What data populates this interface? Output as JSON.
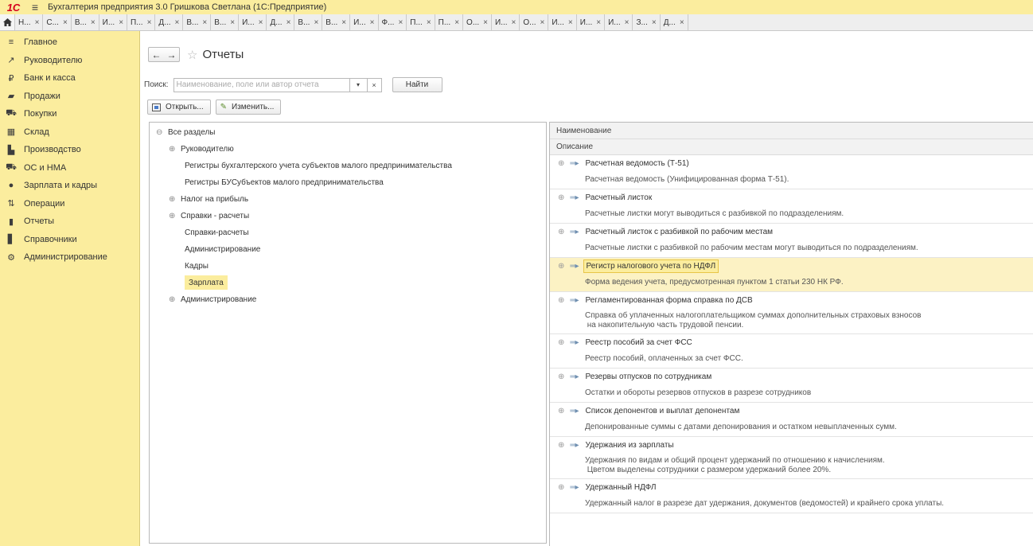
{
  "app": {
    "logo": "1С",
    "title": "Бухгалтерия предприятия 3.0 Гришкова Светлана  (1С:Предприятие)"
  },
  "tabs": [
    {
      "label": "Н..."
    },
    {
      "label": "С..."
    },
    {
      "label": "В..."
    },
    {
      "label": "И..."
    },
    {
      "label": "П..."
    },
    {
      "label": "Д..."
    },
    {
      "label": "В..."
    },
    {
      "label": "В..."
    },
    {
      "label": "И..."
    },
    {
      "label": "Д..."
    },
    {
      "label": "В..."
    },
    {
      "label": "В..."
    },
    {
      "label": "И..."
    },
    {
      "label": "Ф..."
    },
    {
      "label": "П..."
    },
    {
      "label": "П..."
    },
    {
      "label": "О..."
    },
    {
      "label": "И..."
    },
    {
      "label": "О..."
    },
    {
      "label": "И..."
    },
    {
      "label": "И..."
    },
    {
      "label": "И..."
    },
    {
      "label": "З..."
    },
    {
      "label": "Д..."
    }
  ],
  "sidebar": {
    "items": [
      {
        "label": "Главное",
        "icon": "menu-lines-icon"
      },
      {
        "label": "Руководителю",
        "icon": "trend-icon"
      },
      {
        "label": "Банк и касса",
        "icon": "ruble-icon"
      },
      {
        "label": "Продажи",
        "icon": "bag-icon"
      },
      {
        "label": "Покупки",
        "icon": "cart-icon"
      },
      {
        "label": "Склад",
        "icon": "warehouse-icon"
      },
      {
        "label": "Производство",
        "icon": "factory-icon"
      },
      {
        "label": "ОС и НМА",
        "icon": "truck-icon"
      },
      {
        "label": "Зарплата и кадры",
        "icon": "person-icon"
      },
      {
        "label": "Операции",
        "icon": "dt-kt-icon"
      },
      {
        "label": "Отчеты",
        "icon": "bar-chart-icon"
      },
      {
        "label": "Справочники",
        "icon": "book-icon"
      },
      {
        "label": "Администрирование",
        "icon": "gear-icon"
      }
    ]
  },
  "page": {
    "title": "Отчеты",
    "search_label": "Поиск:",
    "search_placeholder": "Наименование, поле или автор отчета",
    "find_label": "Найти",
    "open_label": "Открыть...",
    "edit_label": "Изменить..."
  },
  "tree": {
    "items": [
      {
        "label": "Все разделы",
        "exp": "⊖"
      },
      {
        "label": "Руководителю",
        "exp": "⊕"
      },
      {
        "label": "Регистры бухгалтерского учета субъектов малого предпринимательства",
        "exp": ""
      },
      {
        "label": "Регистры БУСубъектов малого предпринимательства",
        "exp": ""
      },
      {
        "label": "Налог на прибыль",
        "exp": "⊕"
      },
      {
        "label": "Справки - расчеты",
        "exp": "⊕"
      },
      {
        "label": "Справки-расчеты",
        "exp": ""
      },
      {
        "label": "Администрирование",
        "exp": ""
      },
      {
        "label": "Кадры",
        "exp": ""
      },
      {
        "label": "Зарплата",
        "exp": ""
      },
      {
        "label": "Администрирование",
        "exp": "⊕"
      }
    ]
  },
  "list": {
    "head_name": "Наименование",
    "head_desc": "Описание",
    "reports": [
      {
        "name": "Расчетная ведомость (Т-51)",
        "desc1": "Расчетная ведомость (Унифицированная форма Т-51).",
        "desc2": ""
      },
      {
        "name": "Расчетный листок",
        "desc1": "Расчетные листки могут выводиться с разбивкой по подразделениям.",
        "desc2": ""
      },
      {
        "name": "Расчетный листок с разбивкой по рабочим местам",
        "desc1": "Расчетные листки с разбивкой по рабочим местам могут выводиться по подразделениям.",
        "desc2": ""
      },
      {
        "name": "Регистр налогового учета по НДФЛ",
        "desc1": "Форма ведения учета, предусмотренная пунктом 1 статьи 230 НК РФ.",
        "desc2": ""
      },
      {
        "name": "Регламентированная форма справка по ДСВ",
        "desc1": "Справка об уплаченных налогоплательщиком суммах дополнительных страховых взносов",
        "desc2": " на накопительную часть трудовой пенсии."
      },
      {
        "name": "Реестр пособий за счет ФСС",
        "desc1": "Реестр пособий, оплаченных за счет ФСС.",
        "desc2": ""
      },
      {
        "name": "Резервы отпусков по сотрудникам",
        "desc1": "Остатки и обороты резервов отпусков в разрезе сотрудников",
        "desc2": ""
      },
      {
        "name": "Список депонентов и выплат депонентам",
        "desc1": "Депонированные суммы с датами депонирования и остатком невыплаченных сумм.",
        "desc2": ""
      },
      {
        "name": "Удержания из зарплаты",
        "desc1": "Удержания по видам и общий процент удержаний по отношению к начислениям.",
        "desc2": " Цветом выделены сотрудники с размером удержаний более 20%."
      },
      {
        "name": "Удержанный НДФЛ",
        "desc1": "Удержанный налог в разрезе дат удержания, документов (ведомостей) и крайнего срока уплаты.",
        "desc2": ""
      }
    ]
  },
  "colors": {
    "accent_yellow": "#fbed9e",
    "logo_red": "#d5001c"
  }
}
